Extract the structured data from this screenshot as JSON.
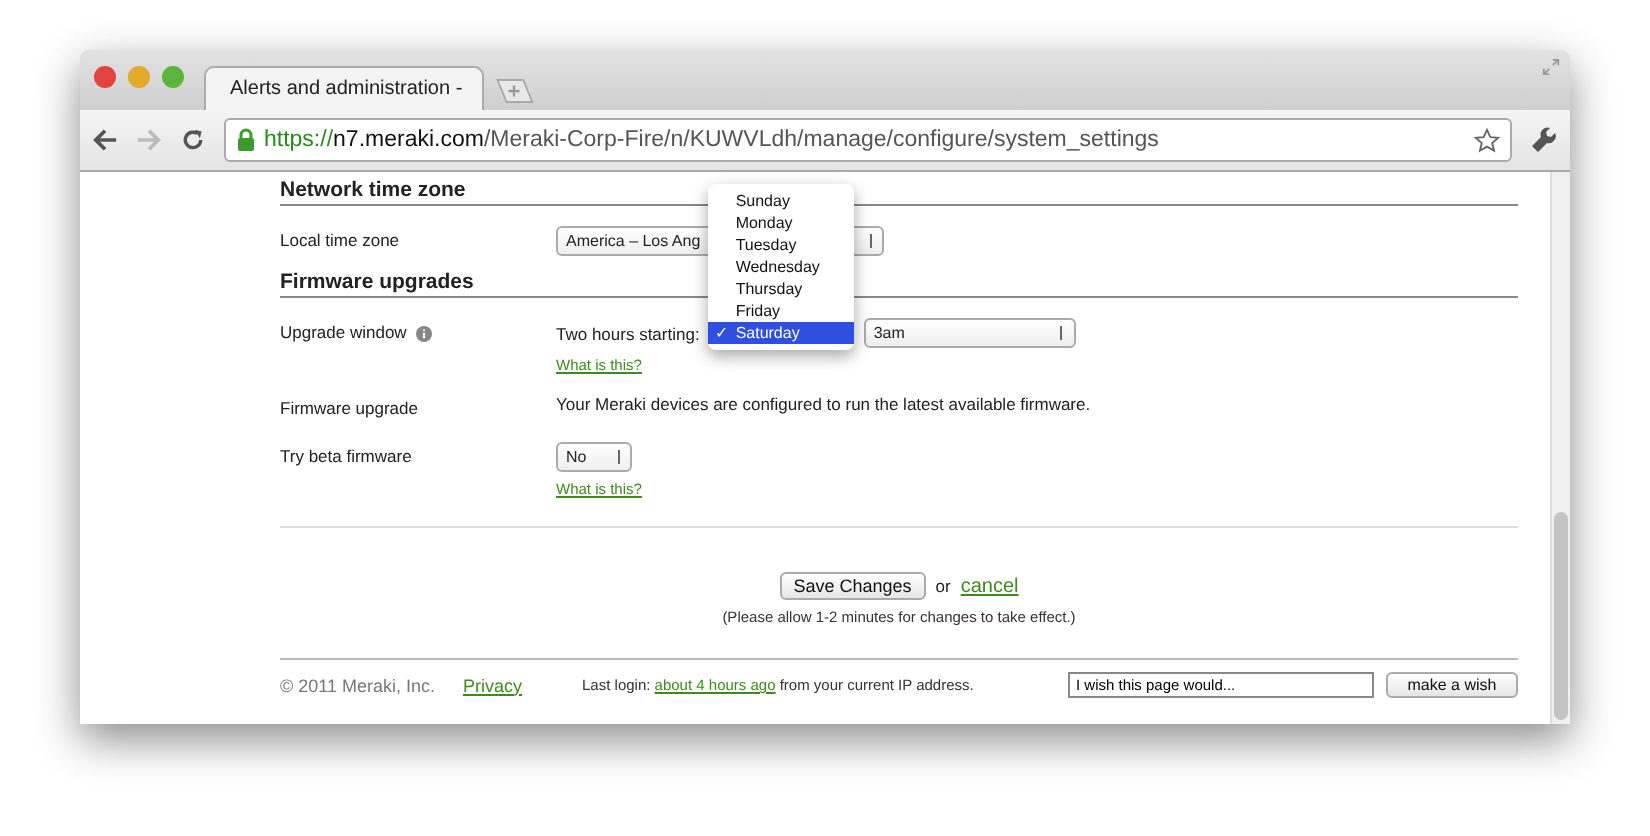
{
  "browser": {
    "tab": {
      "title": "Alerts and administration -",
      "selected": true
    },
    "url": {
      "scheme": "https://",
      "host": "n7.meraki.com",
      "path": "/Meraki-Corp-Fire/n/KUWVLdh/manage/configure/system_settings"
    }
  },
  "sections": [
    {
      "title": "Network time zone",
      "rows": [
        {
          "kind": "select",
          "label": "Local time zone",
          "value": "America – Los Ang"
        }
      ]
    },
    {
      "title": "Firmware upgrades",
      "rows": [
        {
          "kind": "window",
          "label": "Upgrade window",
          "info": true,
          "prefix": "Two hours starting:",
          "time": "3am",
          "help": "What is this?"
        },
        {
          "kind": "text",
          "label": "Firmware upgrade",
          "text": "Your Meraki devices are configured to run the latest available firmware."
        },
        {
          "kind": "select",
          "label": "Try beta firmware",
          "value": "No",
          "help": "What is this?"
        }
      ]
    }
  ],
  "day_menu": [
    {
      "label": "Sunday",
      "selected": false
    },
    {
      "label": "Monday",
      "selected": false
    },
    {
      "label": "Tuesday",
      "selected": false
    },
    {
      "label": "Wednesday",
      "selected": false
    },
    {
      "label": "Thursday",
      "selected": false
    },
    {
      "label": "Friday",
      "selected": false
    },
    {
      "label": "Saturday",
      "selected": true
    }
  ],
  "check_mark": "✓",
  "actions": {
    "save": "Save Changes",
    "or": "or",
    "cancel": "cancel",
    "note": "(Please allow 1-2 minutes for changes to take effect.)"
  },
  "footer": {
    "copyright": "© 2011 Meraki, Inc.",
    "privacy": "Privacy",
    "login_prefix": "Last login:",
    "login_link": "about 4 hours ago",
    "login_suffix": "from your current IP address.",
    "wish_value": "I wish this page would...",
    "wish_button": "make a wish"
  }
}
